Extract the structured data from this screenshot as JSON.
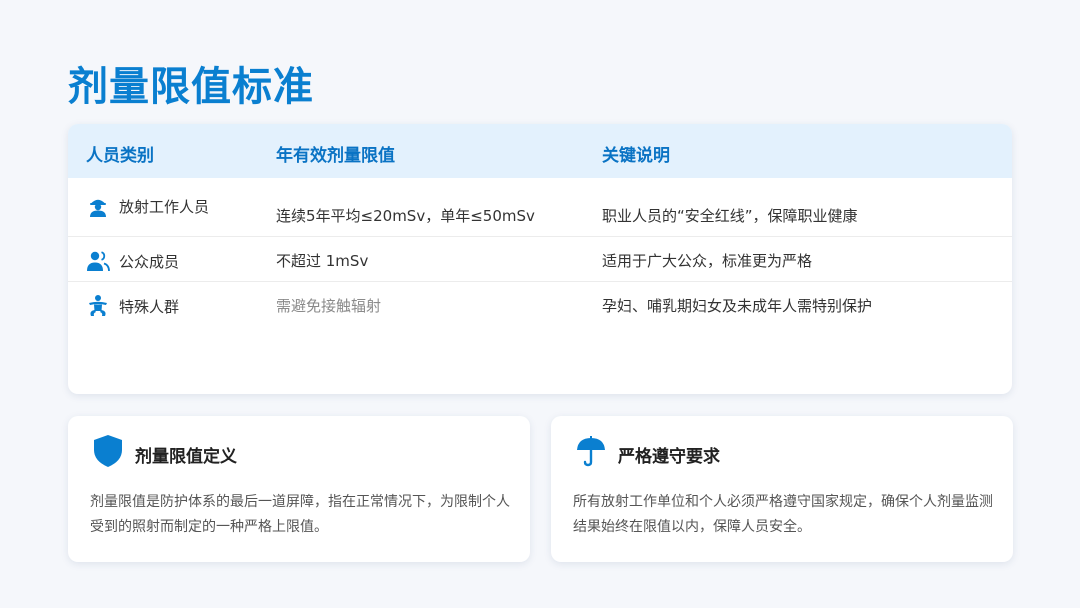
{
  "page": {
    "title": "剂量限值标准"
  },
  "table": {
    "headers": [
      "人员类别",
      "年有效剂量限值",
      "关键说明"
    ],
    "rows": [
      {
        "icon": "worker-icon",
        "category": "放射工作人员",
        "limit": "连续5年平均≤20mSv，单年≤50mSv",
        "note": "职业人员的“安全红线”，保障职业健康"
      },
      {
        "icon": "public-icon",
        "category": "公众成员",
        "limit": "不超过 1mSv",
        "note": "适用于广大公众，标准更为严格"
      },
      {
        "icon": "special-person-icon",
        "category": "特殊人群",
        "limit": "需避免接触辐射",
        "note": "孕妇、哺乳期妇女及未成年人需特别保护"
      }
    ]
  },
  "cards": [
    {
      "icon": "shield-icon",
      "title": "剂量限值定义",
      "body": "剂量限值是防护体系的最后一道屏障，指在正常情况下，为限制个人受到的照射而制定的一种严格上限值。"
    },
    {
      "icon": "umbrella-icon",
      "title": "严格遵守要求",
      "body": "所有放射工作单位和个人必须严格遵守国家规定，确保个人剂量监测结果始终在限值以内，保障人员安全。"
    }
  ],
  "colors": {
    "accent": "#0a7fd0",
    "header_bg": "#e3f1fd",
    "page_bg": "#f5f7fb"
  }
}
